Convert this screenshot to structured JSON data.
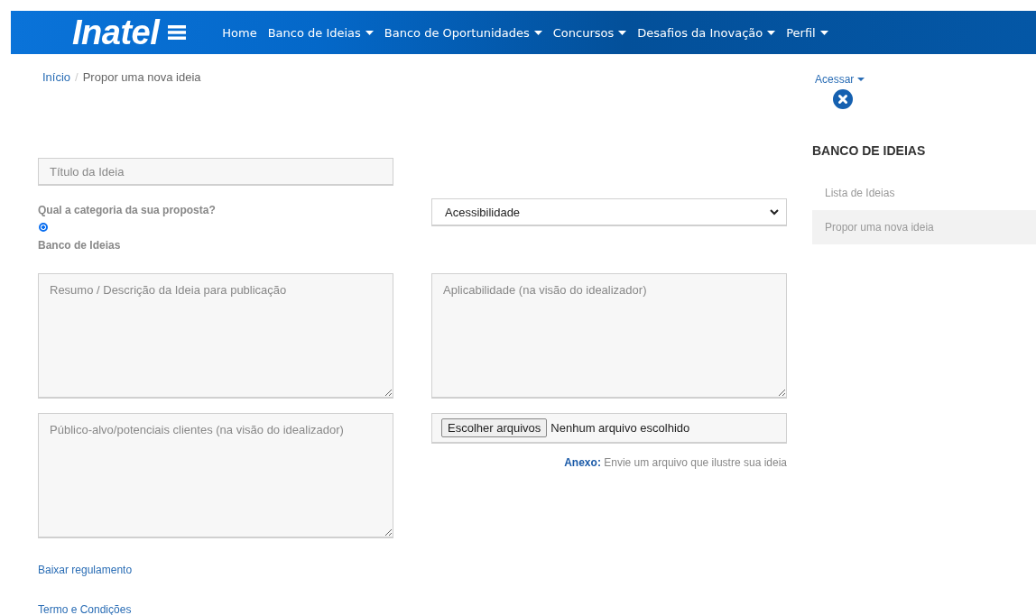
{
  "header": {
    "logo": "Inatel",
    "nav": [
      {
        "label": "Home",
        "dropdown": false
      },
      {
        "label": "Banco de Ideias",
        "dropdown": true
      },
      {
        "label": "Banco de Oportunidades",
        "dropdown": true
      },
      {
        "label": "Concursos",
        "dropdown": true
      },
      {
        "label": "Desafios da Inovação",
        "dropdown": true
      },
      {
        "label": "Perfil",
        "dropdown": true
      }
    ]
  },
  "breadcrumb_separator": "/",
  "breadcrumb": [
    {
      "label": "Início",
      "kind": "link"
    },
    {
      "label": "Propor uma nova ideia",
      "kind": "current"
    }
  ],
  "form": {
    "title_field": {
      "placeholder": "Título da Ideia"
    },
    "category_question": "Qual a categoria da sua proposta?",
    "category_options": [
      {
        "label": "Banco de Ideias",
        "selected": true
      }
    ],
    "category_select": {
      "value": "Acessibilidade"
    },
    "summary_field": {
      "placeholder": "Resumo / Descrição da Ideia para publicação"
    },
    "applicability_field": {
      "placeholder": "Aplicabilidade (na visão do idealizador)"
    },
    "audience_field": {
      "placeholder": "Público-alvo/potenciais clientes (na visão do idealizador)"
    },
    "file_input": {
      "button": "Escolher arquivos",
      "status": "Nenhum arquivo escolhido"
    },
    "attachment_note": "**Anexo:** Envie um arquivo que ilustre sua ideia",
    "links": [
      "Baixar regulamento",
      "Termo e Condições"
    ]
  },
  "account": {
    "label": "Acessar",
    "dropdown": true
  },
  "sidebar": {
    "heading": "BANCO DE IDEIAS",
    "items": [
      {
        "label": "Lista de Ideias",
        "selected": false
      },
      {
        "label": "Propor uma nova ideia",
        "selected": true
      }
    ]
  }
}
